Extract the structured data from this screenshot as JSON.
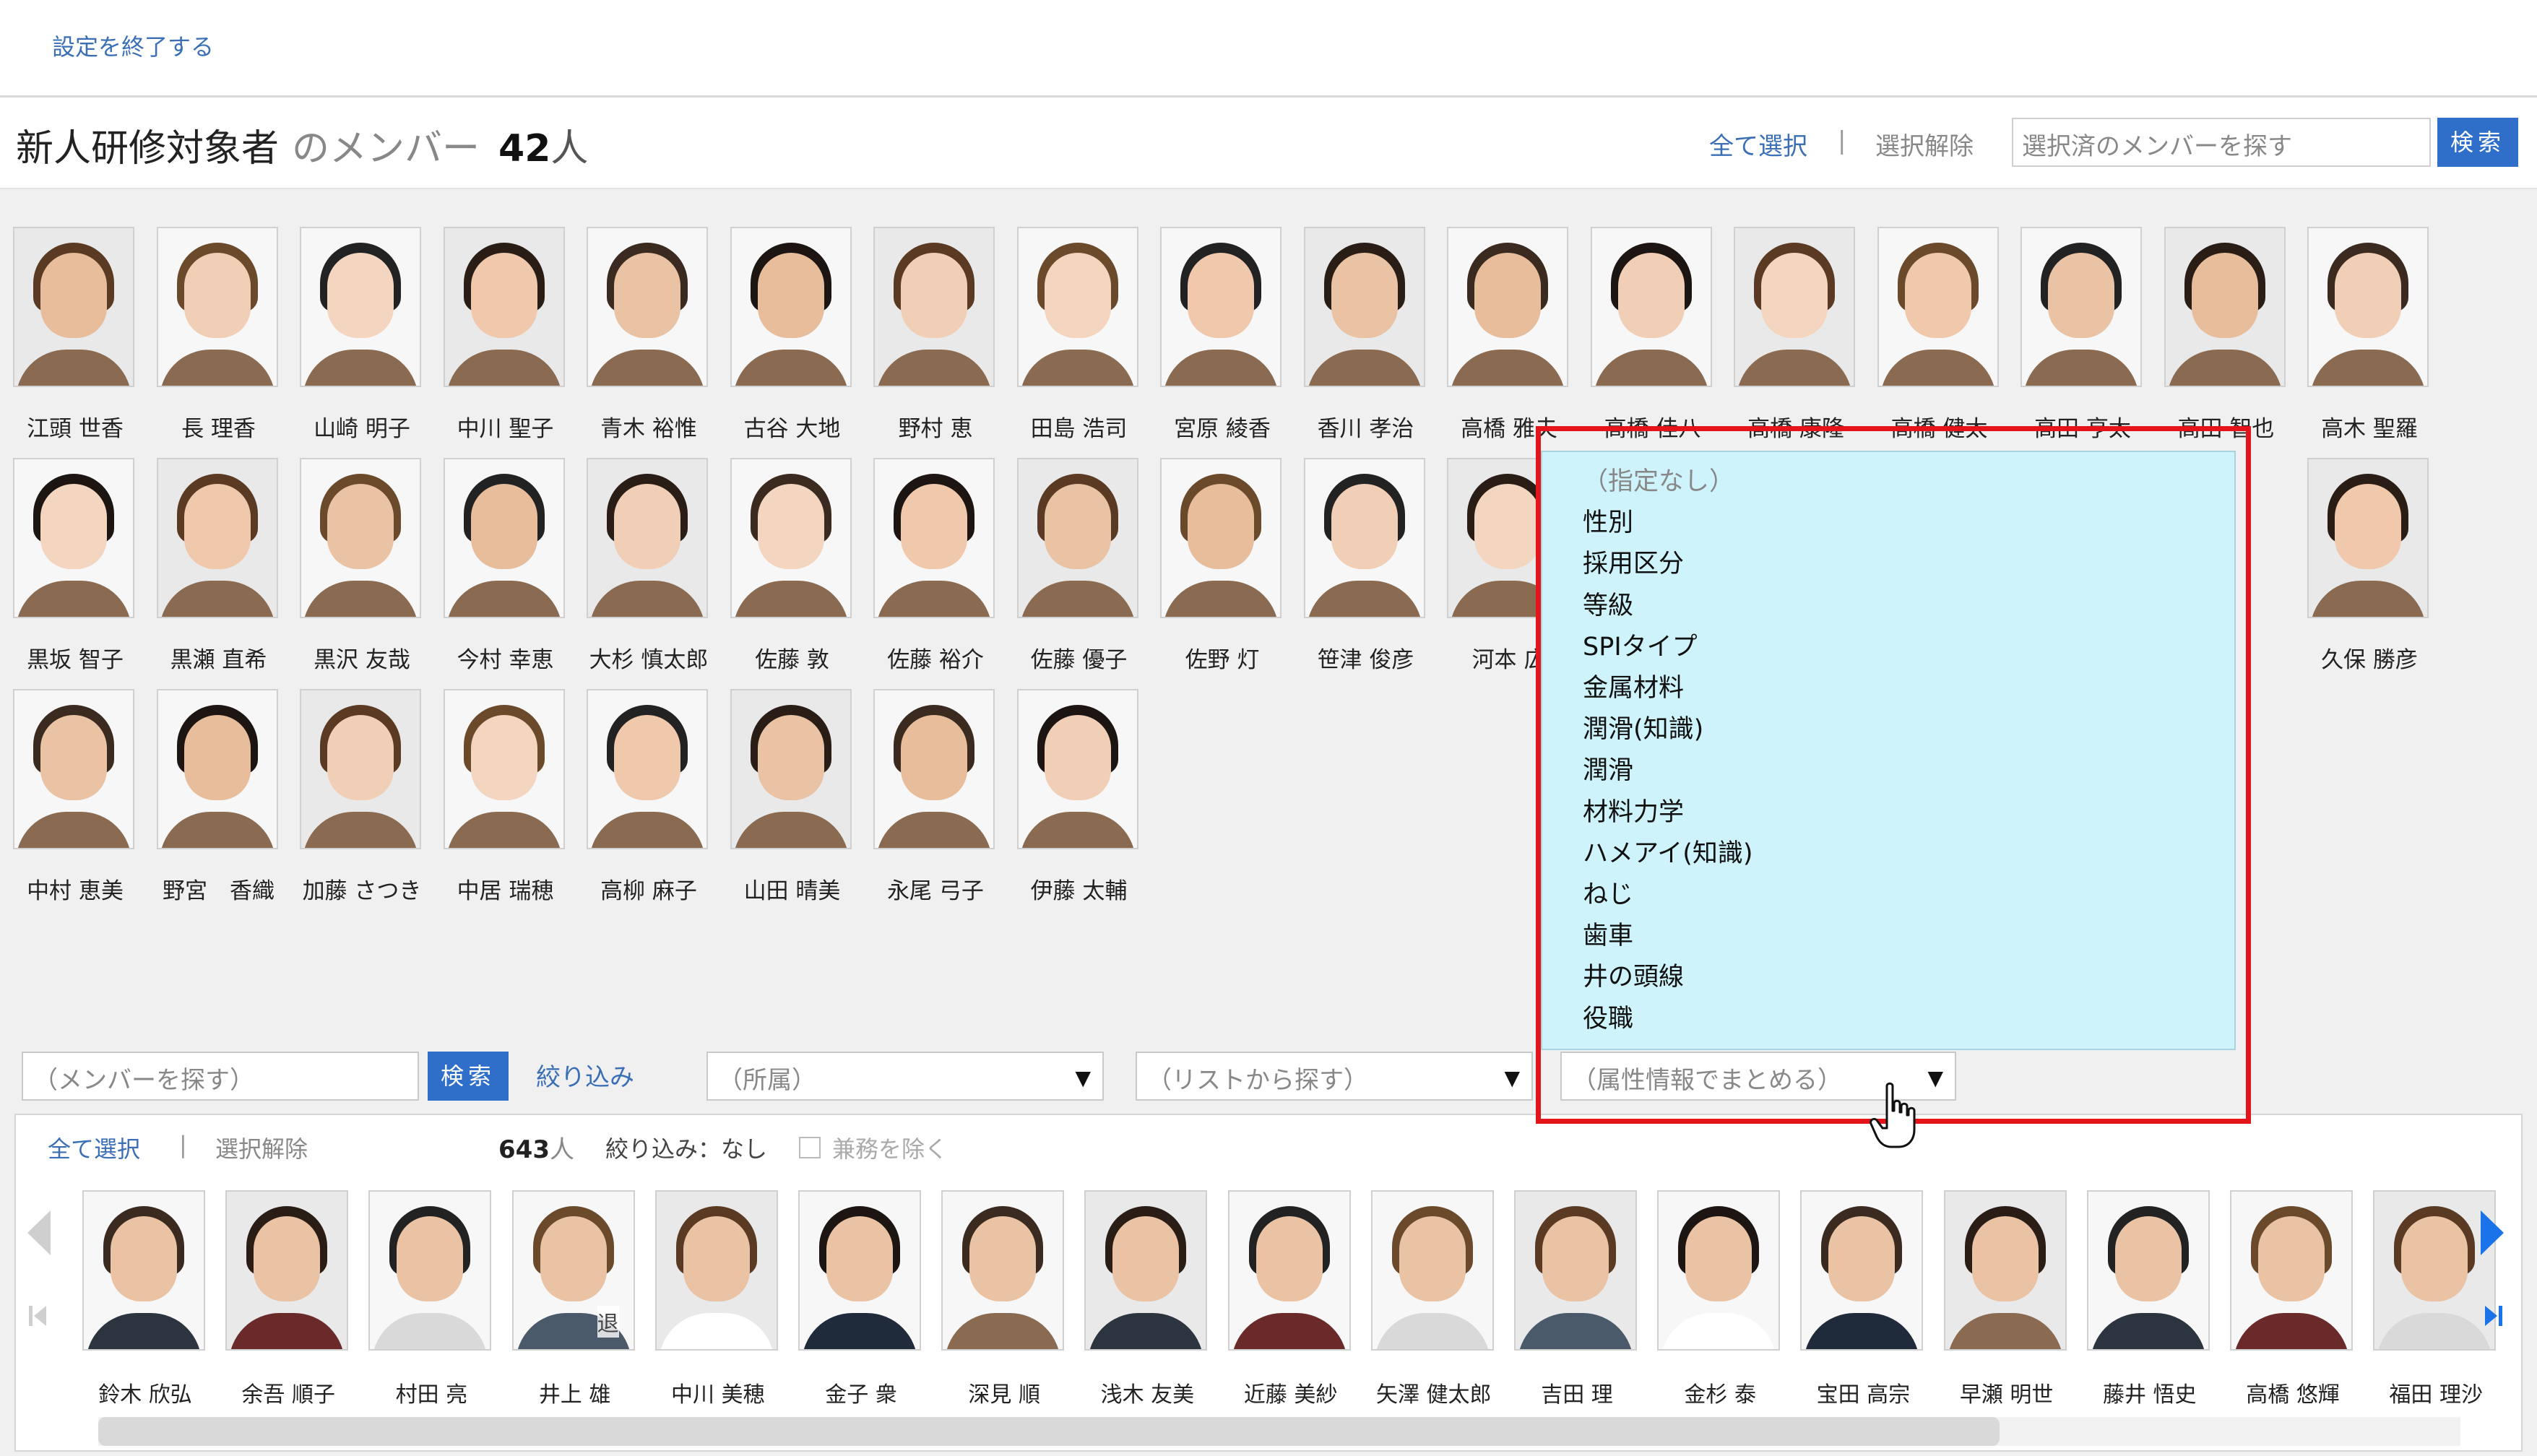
{
  "topbar": {
    "exit_label": "設定を終了する"
  },
  "header": {
    "group_name": "新人研修対象者",
    "members_suffix": "のメンバー",
    "member_count": "42",
    "count_unit": "人",
    "select_all": "全て選択",
    "separator": "|",
    "deselect": "選択解除",
    "search_placeholder": "選択済のメンバーを探す",
    "search_button": "検索"
  },
  "selected_members": [
    "江頭 世香",
    "長 理香",
    "山崎 明子",
    "中川 聖子",
    "青木 裕惟",
    "古谷 大地",
    "野村 恵",
    "田島 浩司",
    "宮原 綾香",
    "香川 孝治",
    "高橋 雅夫",
    "高橋 佳八",
    "高橋 康隆",
    "高橋 健太",
    "高田 亨太",
    "高田 智也",
    "高木 聖羅",
    "黒坂 智子",
    "黒瀬 直希",
    "黒沢 友哉",
    "今村 幸恵",
    "大杉 慎太郎",
    "佐藤 敦",
    "佐藤 裕介",
    "佐藤 優子",
    "佐野 灯",
    "笹津 俊彦",
    "河本 広",
    "",
    "",
    "",
    "",
    "",
    "久保 勝彦",
    "中村 恵美",
    "野宮　香織",
    "加藤 さつき",
    "中居 瑞穂",
    "高柳 麻子",
    "山田 晴美",
    "永尾 弓子",
    "伊藤 太輔"
  ],
  "filter_bar": {
    "member_search_placeholder": "（メンバーを探す）",
    "search_button": "検索",
    "narrow_label": "絞り込み",
    "dept_select": "（所属）",
    "list_select": "（リストから探す）",
    "attr_select": "（属性情報でまとめる）"
  },
  "attr_dropdown": {
    "options": [
      "（指定なし）",
      "性別",
      "採用区分",
      "等級",
      "SPIタイプ",
      "金属材料",
      "潤滑(知識)",
      "潤滑",
      "材料力学",
      "ハメアイ(知識)",
      "ねじ",
      "歯車",
      "井の頭線",
      "役職"
    ]
  },
  "member_list": {
    "select_all": "全て選択",
    "separator": "|",
    "deselect": "選択解除",
    "total_count": "643",
    "count_unit": "人",
    "filter_status": "絞り込み：なし",
    "exclude_label": "兼務を除く",
    "retired_badge": "退",
    "names": [
      "鈴木 欣弘",
      "余吾 順子",
      "村田 亮",
      "井上 雄",
      "中川 美穂",
      "金子 衆",
      "深見 順",
      "浅木 友美",
      "近藤 美紗",
      "矢澤 健太郎",
      "吉田 理",
      "金杉 泰",
      "宝田 高宗",
      "早瀬 明世",
      "藤井 悟史",
      "高橋 悠輝",
      "福田 理沙"
    ]
  }
}
